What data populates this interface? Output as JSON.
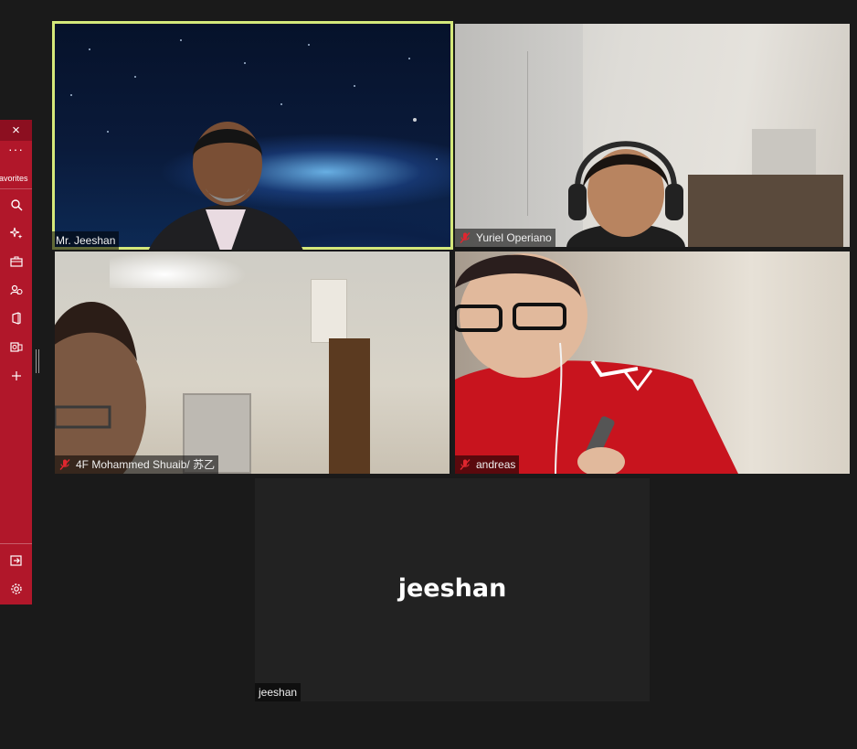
{
  "sidebar": {
    "close_label": "×",
    "more_label": "···",
    "favorites_label": "avorites",
    "icons": [
      "search-icon",
      "sparkle-icon",
      "toolbox-icon",
      "people-icon",
      "office-icon",
      "outlook-icon",
      "add-icon",
      "exit-icon",
      "settings-icon"
    ]
  },
  "participants": [
    {
      "name": "Mr. Jeeshan",
      "muted": false,
      "active_speaker": true,
      "video": true
    },
    {
      "name": "Yuriel Operiano",
      "muted": true,
      "active_speaker": false,
      "video": true
    },
    {
      "name": "4F Mohammed Shuaib/ 苏乙",
      "muted": true,
      "active_speaker": false,
      "video": true
    },
    {
      "name": "andreas",
      "muted": true,
      "active_speaker": false,
      "video": true
    },
    {
      "name": "jeeshan",
      "display_name": "jeeshan",
      "muted": false,
      "active_speaker": false,
      "video": false
    }
  ],
  "colors": {
    "background": "#1a1a1a",
    "sidebar": "#b1172a",
    "active_border": "#d4e87a",
    "muted_icon": "#e0262f"
  }
}
